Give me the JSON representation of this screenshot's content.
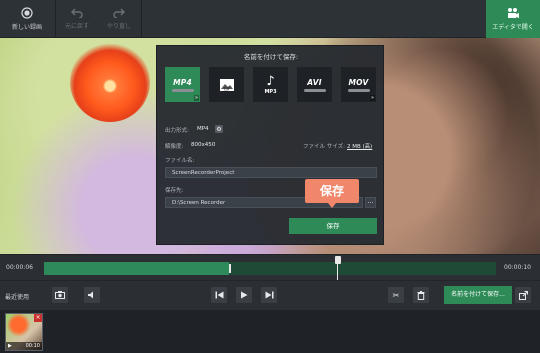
{
  "toolbar": {
    "new_recording_label": "新しい録画",
    "undo_label": "元に戻す",
    "redo_label": "やり直し",
    "open_editor_label": "エディタで開く"
  },
  "dialog": {
    "title": "名前を付けて保存:",
    "formats": [
      {
        "name": "MP4",
        "icon": "mp4-icon",
        "selected": true
      },
      {
        "name": "GIF",
        "icon": "gif-image-icon",
        "selected": false
      },
      {
        "name": "MP3",
        "icon": "music-note-icon",
        "selected": false
      },
      {
        "name": "AVI",
        "icon": "avi-icon",
        "selected": false
      },
      {
        "name": "MOV",
        "icon": "mov-icon",
        "selected": false
      }
    ],
    "output_format_label": "出力形式:",
    "output_format_value": "MP4",
    "resolution_label": "解像度:",
    "resolution_value": "800x450",
    "file_size_label": "ファイル サイズ:",
    "file_size_value": "2 MB (高)",
    "file_name_label": "ファイル名:",
    "file_name_value": "ScreenRecorderProject",
    "save_to_label": "保存先:",
    "save_to_value": "D:\\Screen Recorder",
    "browse_label": "...",
    "save_button": "保存",
    "callout_text": "保存"
  },
  "timeline": {
    "start_time": "00:00:06",
    "end_time": "00:00:10",
    "progress_fraction": 0.41,
    "playhead_fraction": 0.65
  },
  "controls": {
    "recent_label": "最近使用",
    "save_as_label": "名前を付けて保存..."
  },
  "recent": {
    "items": [
      {
        "duration": "00:10"
      }
    ]
  },
  "colors": {
    "accent": "#2e8b57",
    "callout": "#f0876a"
  }
}
